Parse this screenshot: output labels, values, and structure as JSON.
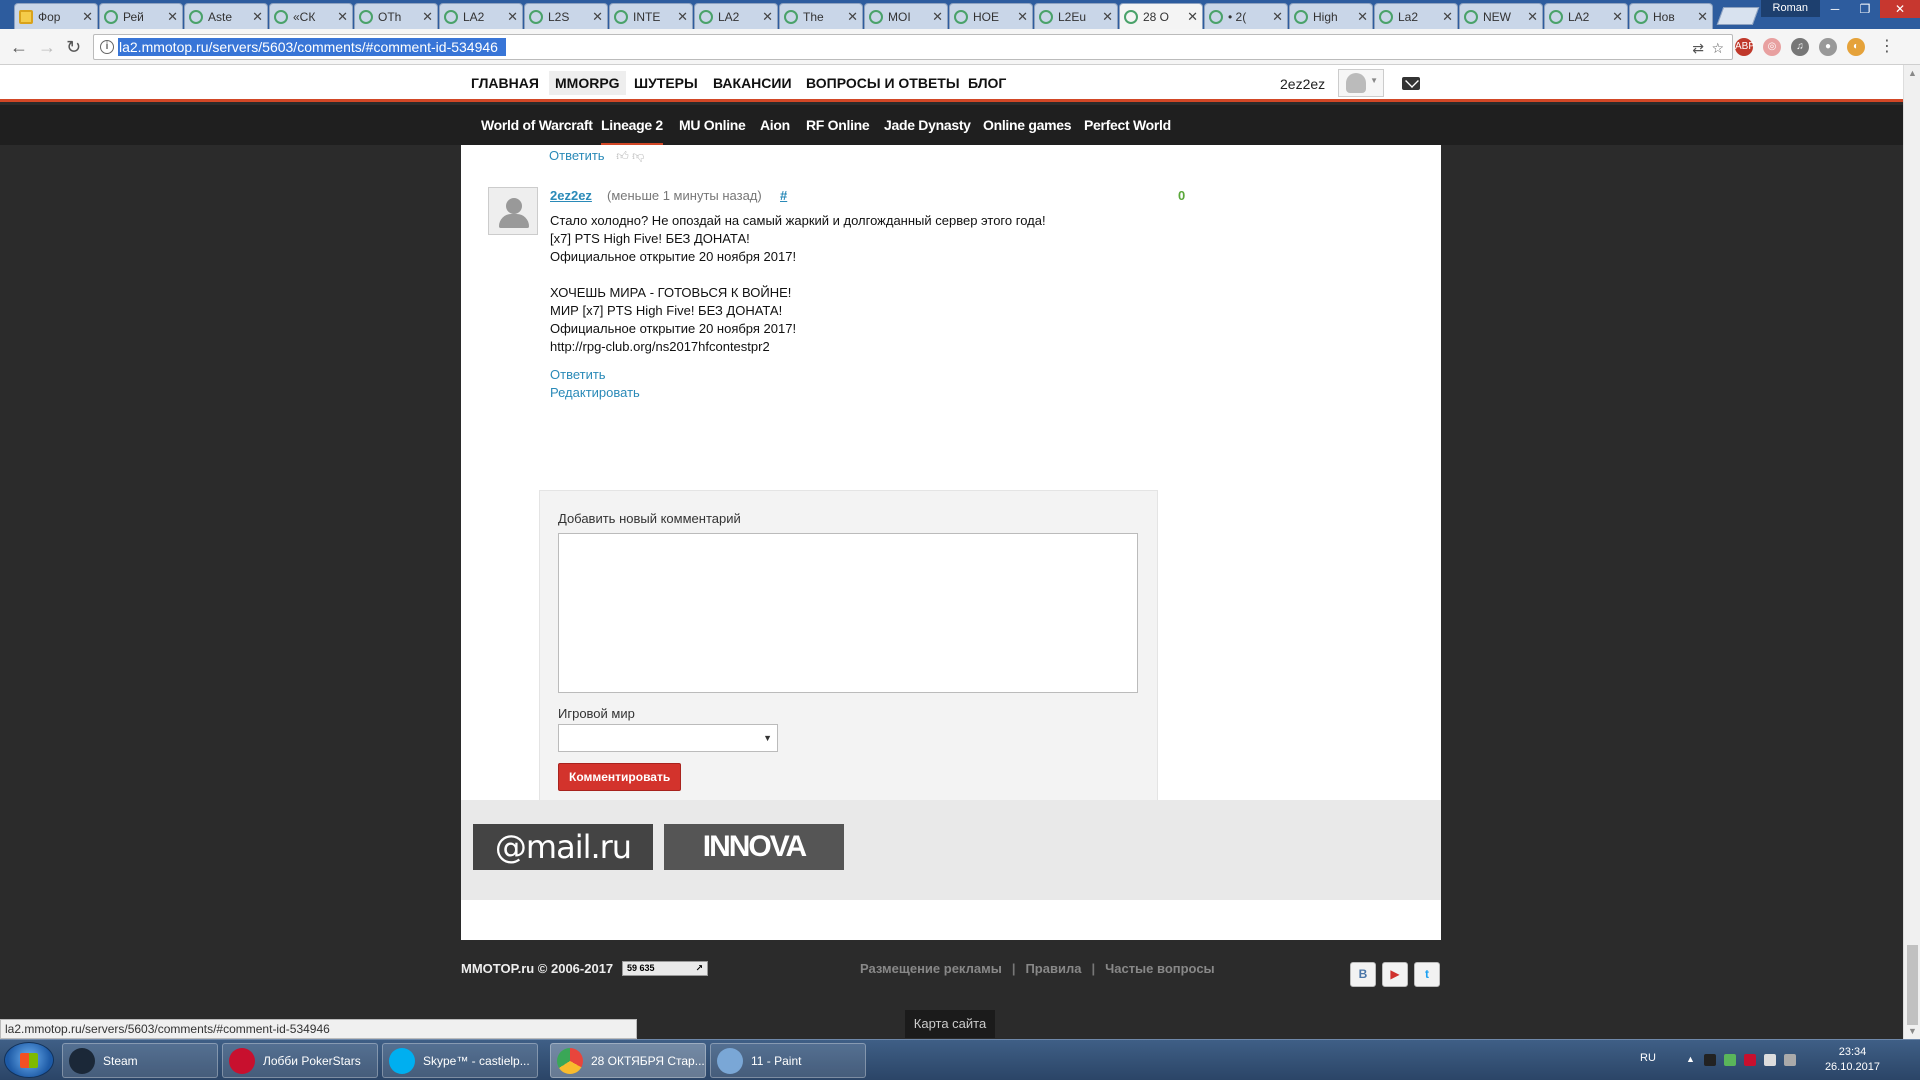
{
  "browser": {
    "tabs": [
      {
        "label": "Фор"
      },
      {
        "label": "Рей"
      },
      {
        "label": "Aste"
      },
      {
        "label": "«СК"
      },
      {
        "label": "ОТh"
      },
      {
        "label": "LA2"
      },
      {
        "label": "L2S"
      },
      {
        "label": "INTE"
      },
      {
        "label": "LA2"
      },
      {
        "label": "The"
      },
      {
        "label": "МОІ"
      },
      {
        "label": "НОЕ"
      },
      {
        "label": "L2Eu"
      },
      {
        "label": "28 О"
      },
      {
        "label": "• 2("
      },
      {
        "label": "High"
      },
      {
        "label": "La2"
      },
      {
        "label": "NEW"
      },
      {
        "label": "LA2"
      },
      {
        "label": "Нов"
      }
    ],
    "window_user": "Roman",
    "url": "la2.mmotop.ru/servers/5603/comments/#comment-id-534946",
    "status_url": "la2.mmotop.ru/servers/5603/comments/#comment-id-534946"
  },
  "site": {
    "top_nav": [
      "ГЛАВНАЯ",
      "MMORPG",
      "ШУТЕРЫ",
      "ВАКАНСИИ",
      "ВОПРОСЫ И ОТВЕТЫ",
      "БЛОГ"
    ],
    "user_name": "2ez2ez",
    "sub_nav": [
      "World of Warcraft",
      "Lineage 2",
      "MU Online",
      "Aion",
      "RF Online",
      "Jade Dynasty",
      "Online games",
      "Perfect World"
    ]
  },
  "comments": {
    "prev_reply": "Ответить",
    "author": "2ez2ez",
    "time": "(меньше 1 минуты назад)",
    "anchor": "#",
    "votes": "0",
    "body_lines": [
      "Стало холодно? Не опоздай на самый жаркий и долгожданный сервер этого года!",
      "[x7] PTS High Five! БЕЗ ДОНАТА!",
      "Официальное открытие 20 ноября 2017!",
      "",
      "ХОЧЕШЬ МИРА - ГОТОВЬСЯ К ВОЙНЕ!",
      "МИР [x7] PTS High Five! БЕЗ ДОНАТА!",
      "Официальное открытие 20 ноября 2017!",
      "http://rpg-club.org/ns2017hfcontestpr2"
    ],
    "reply": "Ответить",
    "edit": "Редактировать"
  },
  "form": {
    "title": "Добавить новый комментарий",
    "world_label": "Игровой мир",
    "world_value": "",
    "submit": "Комментировать"
  },
  "partners": {
    "mailru": "@mail.ru",
    "innova": "INNOVA"
  },
  "footer": {
    "copyright": "MMOTOP.ru © 2006-2017",
    "counter": "59 635",
    "links": [
      "Размещение рекламы",
      "Правила",
      "Частые вопросы"
    ],
    "social": [
      "B",
      "▶",
      "t"
    ],
    "sitemap": "Карта сайта"
  },
  "taskbar": {
    "items": [
      {
        "label": "Steam",
        "color": "#1b2838"
      },
      {
        "label": "Лобби PokerStars",
        "color": "#c8102e"
      },
      {
        "label": "Skype™ - castielp...",
        "color": "#00aff0"
      },
      {
        "label": "28 ОКТЯБРЯ Стар...",
        "color": "#e8453c"
      },
      {
        "label": "11 - Paint",
        "color": "#7aa7d6"
      }
    ],
    "lang": "RU",
    "time": "23:34",
    "date": "26.10.2017"
  },
  "colors": {
    "accent": "#d24726",
    "link": "#2a8ab8",
    "submit": "#d3332c",
    "votes": "#5aa83a"
  }
}
